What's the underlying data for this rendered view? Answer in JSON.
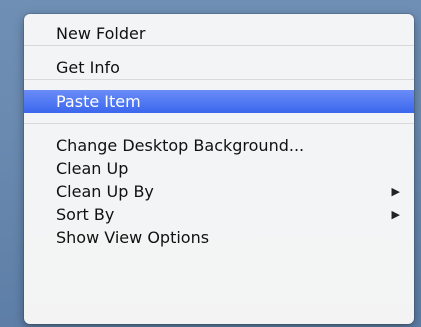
{
  "menu": {
    "items": [
      {
        "label": "New Folder"
      },
      {
        "label": "Get Info"
      },
      {
        "label": "Paste Item"
      },
      {
        "label": "Change Desktop Background..."
      },
      {
        "label": "Clean Up"
      },
      {
        "label": "Clean Up By"
      },
      {
        "label": "Sort By"
      },
      {
        "label": "Show View Options"
      }
    ],
    "submenu_arrow_icon": "triangle-right-icon",
    "highlight_color": "#3b67ee"
  }
}
